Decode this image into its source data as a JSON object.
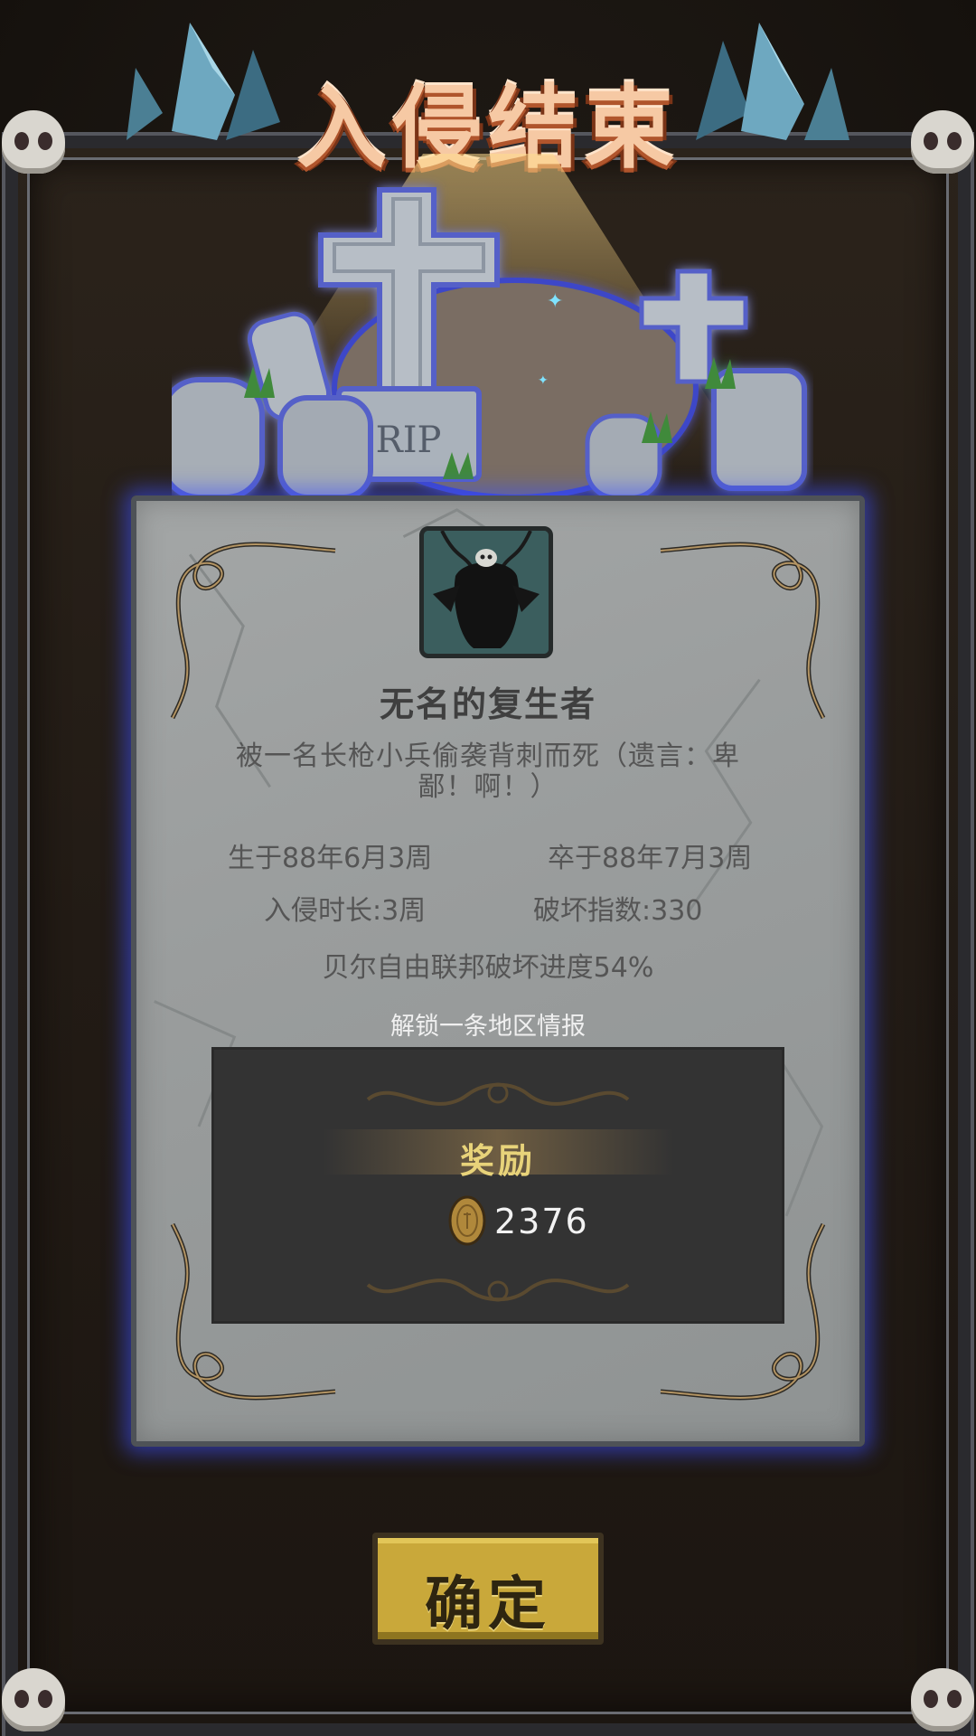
{
  "header": {
    "title": "入侵结束"
  },
  "character": {
    "name": "无名的复生者",
    "cause_of_death": "被一名长枪小兵偷袭背刺而死（遗言：卑鄙！啊！）",
    "born": "生于88年6月3周",
    "died": "卒于88年7月3周",
    "invasion_duration": "入侵时长:3周",
    "destruction_index": "破坏指数:330",
    "progress_text": "贝尔自由联邦破坏进度54%"
  },
  "unlock_text": "解锁一条地区情报",
  "reward": {
    "label": "奖励",
    "currency_icon": "gold-coin-icon",
    "amount": "2376"
  },
  "confirm_button": {
    "label": "确定"
  },
  "colors": {
    "panel_glow": "#3c50ff",
    "title_text": "#f6c9a4",
    "reward_label": "#e8d37a",
    "button": "#c9a83a"
  }
}
